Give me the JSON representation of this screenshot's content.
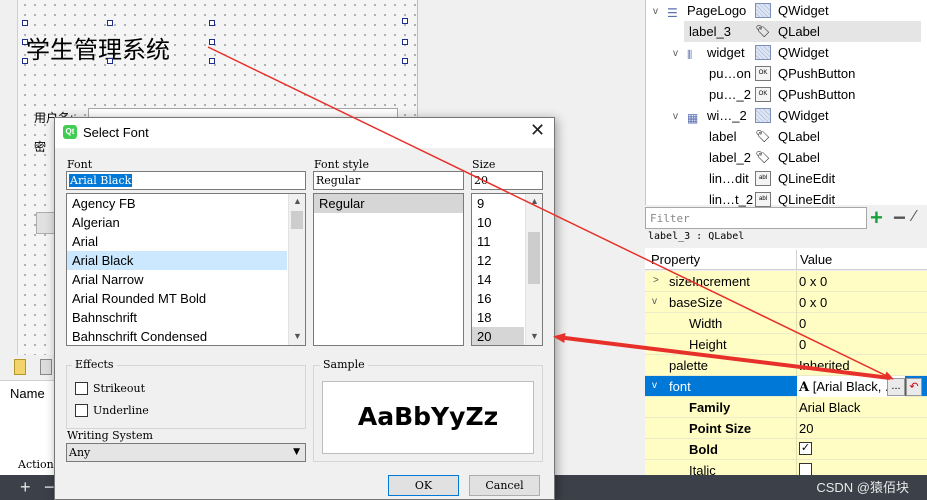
{
  "designer": {
    "title_label": "学生管理系统",
    "bg_text_1": "用户名:",
    "bg_text_2": "密"
  },
  "left_panel": {
    "name_header": "Name",
    "action_label": "Action"
  },
  "bottom_bar": {
    "plus_glyph": "+",
    "minus_glyph": "−",
    "watermark": "CSDN @猿佰块"
  },
  "object_tree": [
    {
      "name": "PageLogo",
      "class": "QWidget",
      "icon": "layout-vertical-icon",
      "expanded": true
    },
    {
      "name": "label_3",
      "class": "QLabel",
      "icon": "label-icon",
      "selected": true
    },
    {
      "name": "widget",
      "class": "QWidget",
      "icon": "layout-horizontal-icon",
      "expanded": true
    },
    {
      "name": "pu…on",
      "class": "QPushButton",
      "icon": "push-button-icon"
    },
    {
      "name": "pu…_2",
      "class": "QPushButton",
      "icon": "push-button-icon"
    },
    {
      "name": "wi…_2",
      "class": "QWidget",
      "icon": "layout-grid-icon",
      "expanded": true
    },
    {
      "name": "label",
      "class": "QLabel",
      "icon": "label-icon"
    },
    {
      "name": "label_2",
      "class": "QLabel",
      "icon": "label-icon"
    },
    {
      "name": "lin…dit",
      "class": "QLineEdit",
      "icon": "line-edit-icon"
    },
    {
      "name": "lin…t_2",
      "class": "QLineEdit",
      "icon": "line-edit-icon"
    }
  ],
  "filter": {
    "placeholder": "Filter",
    "add_glyph": "+",
    "remove_glyph": "−",
    "tool_glyph": "⁄"
  },
  "property_editor": {
    "object_caption": "label_3 : QLabel",
    "col_property": "Property",
    "col_value": "Value",
    "rows": [
      {
        "name": "sizeIncrement",
        "value": "0 x 0"
      },
      {
        "name": "baseSize",
        "value": "0 x 0"
      },
      {
        "name": "Width",
        "value": "0"
      },
      {
        "name": "Height",
        "value": "0"
      },
      {
        "name": "palette",
        "value": "Inherited"
      },
      {
        "name": "font",
        "value": "[Arial Black, ..."
      },
      {
        "name": "Family",
        "value": "Arial Black"
      },
      {
        "name": "Point Size",
        "value": "20"
      },
      {
        "name": "Bold",
        "value": "checked"
      },
      {
        "name": "Italic",
        "value": "unchecked"
      }
    ],
    "font_dots": "...",
    "font_reset": "↶"
  },
  "dialog": {
    "title": "Select Font",
    "icon_text": "Qt",
    "font_label": "Font",
    "font_value": "Arial Black",
    "style_label": "Font style",
    "style_value": "Regular",
    "size_label": "Size",
    "size_value": "20",
    "fonts": [
      "Agency FB",
      "Algerian",
      "Arial",
      "Arial Black",
      "Arial Narrow",
      "Arial Rounded MT Bold",
      "Bahnschrift",
      "Bahnschrift Condensed"
    ],
    "styles": [
      "Regular"
    ],
    "sizes": [
      "9",
      "10",
      "11",
      "12",
      "14",
      "16",
      "18",
      "20"
    ],
    "effects_label": "Effects",
    "strikeout_label": "Strikeout",
    "underline_label": "Underline",
    "sample_label": "Sample",
    "sample_text": "AaBbYyZz",
    "writing_system_label": "Writing System",
    "writing_system_value": "Any",
    "ok_label": "OK",
    "cancel_label": "Cancel"
  },
  "colors": {
    "annotation_arrow": "#e8302a",
    "selection_blue": "#0078d7",
    "property_yellow": "#fffdc4",
    "list_highlight": "#cce8ff"
  }
}
